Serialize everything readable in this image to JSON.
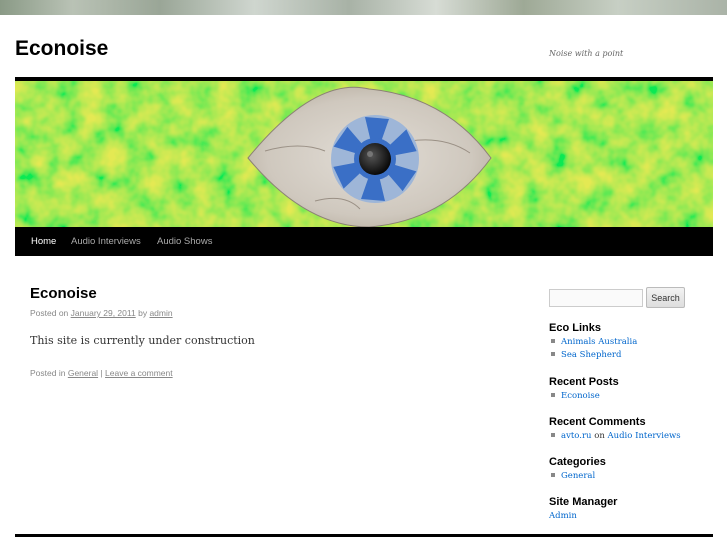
{
  "site": {
    "title": "Econoise",
    "description": "Noise with a point"
  },
  "nav": {
    "items": [
      "Home",
      "Audio Interviews",
      "Audio Shows"
    ]
  },
  "post": {
    "title": "Econoise",
    "posted_on_prefix": "Posted on",
    "date": "January 29, 2011",
    "by_label": "by",
    "author": "admin",
    "content": "This site is currently under construction",
    "posted_in_prefix": "Posted in",
    "category": "General",
    "separator": "|",
    "comment_link": "Leave a comment"
  },
  "sidebar": {
    "search_button": "Search",
    "search_value": "",
    "eco_links": {
      "title": "Eco Links",
      "items": [
        "Animals Australia",
        "Sea Shepherd"
      ]
    },
    "recent_posts": {
      "title": "Recent Posts",
      "items": [
        "Econoise"
      ]
    },
    "recent_comments": {
      "title": "Recent Comments",
      "author": "avto.ru",
      "on_label": "on",
      "post": "Audio Interviews"
    },
    "categories": {
      "title": "Categories",
      "items": [
        "General"
      ]
    },
    "site_manager": {
      "title": "Site Manager",
      "link": "Admin"
    }
  },
  "colors": {
    "link": "#0066cc",
    "nav_bg": "#000000",
    "banner_green": "#4cd432",
    "iris_blue": "#3a6fc6"
  }
}
